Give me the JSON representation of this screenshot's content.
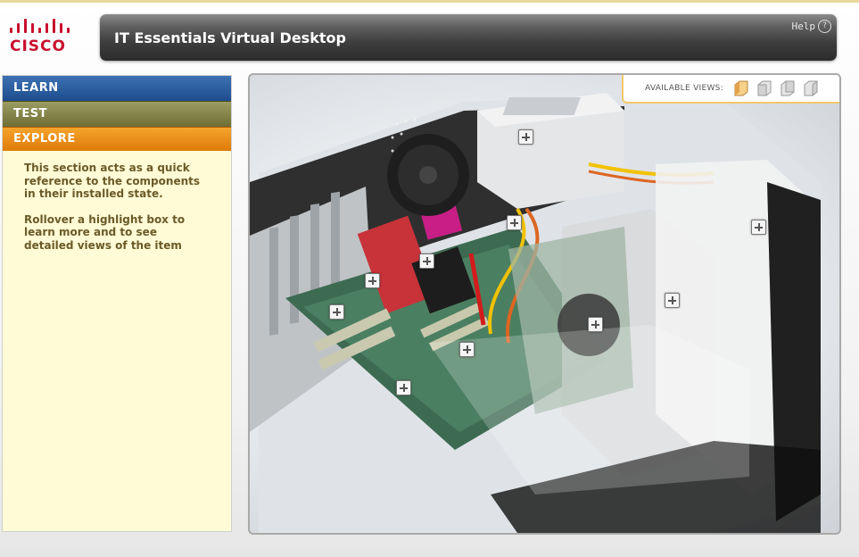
{
  "header": {
    "logo_text": "CISCO",
    "title": "IT Essentials Virtual Desktop",
    "help_label": "Help",
    "help_icon_glyph": "?"
  },
  "sidebar": {
    "nav": [
      {
        "label": "LEARN",
        "color": "#1d4c8d"
      },
      {
        "label": "TEST",
        "color": "#6f6e34"
      },
      {
        "label": "EXPLORE",
        "color": "#df7b09",
        "active": true
      }
    ],
    "description": [
      "This section acts as a quick reference to the components in their installed state.",
      "Rollover a highlight box to learn more and to see detailed views of the item"
    ]
  },
  "viewer": {
    "available_views_label": "AVAILABLE VIEWS:",
    "views": [
      "front-left-view-icon",
      "front-view-icon",
      "back-view-icon",
      "right-view-icon"
    ],
    "active_view": 0,
    "hotspots": [
      "power-supply",
      "cpu-fan",
      "video-card",
      "expansion-card",
      "motherboard",
      "drive-cage",
      "hard-drive",
      "cables",
      "optical-drive",
      "chipset"
    ]
  },
  "colors": {
    "accent_orange": "#df7b09",
    "panel_background": "#fffbd6",
    "hotspot_border": "#777777"
  }
}
